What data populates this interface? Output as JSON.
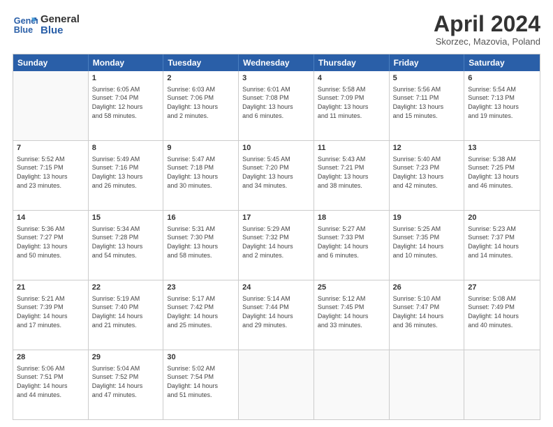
{
  "logo": {
    "line1": "General",
    "line2": "Blue"
  },
  "title": "April 2024",
  "subtitle": "Skorzec, Mazovia, Poland",
  "header": {
    "days": [
      "Sunday",
      "Monday",
      "Tuesday",
      "Wednesday",
      "Thursday",
      "Friday",
      "Saturday"
    ]
  },
  "rows": [
    [
      {
        "date": "",
        "info": ""
      },
      {
        "date": "1",
        "info": "Sunrise: 6:05 AM\nSunset: 7:04 PM\nDaylight: 12 hours\nand 58 minutes."
      },
      {
        "date": "2",
        "info": "Sunrise: 6:03 AM\nSunset: 7:06 PM\nDaylight: 13 hours\nand 2 minutes."
      },
      {
        "date": "3",
        "info": "Sunrise: 6:01 AM\nSunset: 7:08 PM\nDaylight: 13 hours\nand 6 minutes."
      },
      {
        "date": "4",
        "info": "Sunrise: 5:58 AM\nSunset: 7:09 PM\nDaylight: 13 hours\nand 11 minutes."
      },
      {
        "date": "5",
        "info": "Sunrise: 5:56 AM\nSunset: 7:11 PM\nDaylight: 13 hours\nand 15 minutes."
      },
      {
        "date": "6",
        "info": "Sunrise: 5:54 AM\nSunset: 7:13 PM\nDaylight: 13 hours\nand 19 minutes."
      }
    ],
    [
      {
        "date": "7",
        "info": "Sunrise: 5:52 AM\nSunset: 7:15 PM\nDaylight: 13 hours\nand 23 minutes."
      },
      {
        "date": "8",
        "info": "Sunrise: 5:49 AM\nSunset: 7:16 PM\nDaylight: 13 hours\nand 26 minutes."
      },
      {
        "date": "9",
        "info": "Sunrise: 5:47 AM\nSunset: 7:18 PM\nDaylight: 13 hours\nand 30 minutes."
      },
      {
        "date": "10",
        "info": "Sunrise: 5:45 AM\nSunset: 7:20 PM\nDaylight: 13 hours\nand 34 minutes."
      },
      {
        "date": "11",
        "info": "Sunrise: 5:43 AM\nSunset: 7:21 PM\nDaylight: 13 hours\nand 38 minutes."
      },
      {
        "date": "12",
        "info": "Sunrise: 5:40 AM\nSunset: 7:23 PM\nDaylight: 13 hours\nand 42 minutes."
      },
      {
        "date": "13",
        "info": "Sunrise: 5:38 AM\nSunset: 7:25 PM\nDaylight: 13 hours\nand 46 minutes."
      }
    ],
    [
      {
        "date": "14",
        "info": "Sunrise: 5:36 AM\nSunset: 7:27 PM\nDaylight: 13 hours\nand 50 minutes."
      },
      {
        "date": "15",
        "info": "Sunrise: 5:34 AM\nSunset: 7:28 PM\nDaylight: 13 hours\nand 54 minutes."
      },
      {
        "date": "16",
        "info": "Sunrise: 5:31 AM\nSunset: 7:30 PM\nDaylight: 13 hours\nand 58 minutes."
      },
      {
        "date": "17",
        "info": "Sunrise: 5:29 AM\nSunset: 7:32 PM\nDaylight: 14 hours\nand 2 minutes."
      },
      {
        "date": "18",
        "info": "Sunrise: 5:27 AM\nSunset: 7:33 PM\nDaylight: 14 hours\nand 6 minutes."
      },
      {
        "date": "19",
        "info": "Sunrise: 5:25 AM\nSunset: 7:35 PM\nDaylight: 14 hours\nand 10 minutes."
      },
      {
        "date": "20",
        "info": "Sunrise: 5:23 AM\nSunset: 7:37 PM\nDaylight: 14 hours\nand 14 minutes."
      }
    ],
    [
      {
        "date": "21",
        "info": "Sunrise: 5:21 AM\nSunset: 7:39 PM\nDaylight: 14 hours\nand 17 minutes."
      },
      {
        "date": "22",
        "info": "Sunrise: 5:19 AM\nSunset: 7:40 PM\nDaylight: 14 hours\nand 21 minutes."
      },
      {
        "date": "23",
        "info": "Sunrise: 5:17 AM\nSunset: 7:42 PM\nDaylight: 14 hours\nand 25 minutes."
      },
      {
        "date": "24",
        "info": "Sunrise: 5:14 AM\nSunset: 7:44 PM\nDaylight: 14 hours\nand 29 minutes."
      },
      {
        "date": "25",
        "info": "Sunrise: 5:12 AM\nSunset: 7:45 PM\nDaylight: 14 hours\nand 33 minutes."
      },
      {
        "date": "26",
        "info": "Sunrise: 5:10 AM\nSunset: 7:47 PM\nDaylight: 14 hours\nand 36 minutes."
      },
      {
        "date": "27",
        "info": "Sunrise: 5:08 AM\nSunset: 7:49 PM\nDaylight: 14 hours\nand 40 minutes."
      }
    ],
    [
      {
        "date": "28",
        "info": "Sunrise: 5:06 AM\nSunset: 7:51 PM\nDaylight: 14 hours\nand 44 minutes."
      },
      {
        "date": "29",
        "info": "Sunrise: 5:04 AM\nSunset: 7:52 PM\nDaylight: 14 hours\nand 47 minutes."
      },
      {
        "date": "30",
        "info": "Sunrise: 5:02 AM\nSunset: 7:54 PM\nDaylight: 14 hours\nand 51 minutes."
      },
      {
        "date": "",
        "info": ""
      },
      {
        "date": "",
        "info": ""
      },
      {
        "date": "",
        "info": ""
      },
      {
        "date": "",
        "info": ""
      }
    ]
  ]
}
